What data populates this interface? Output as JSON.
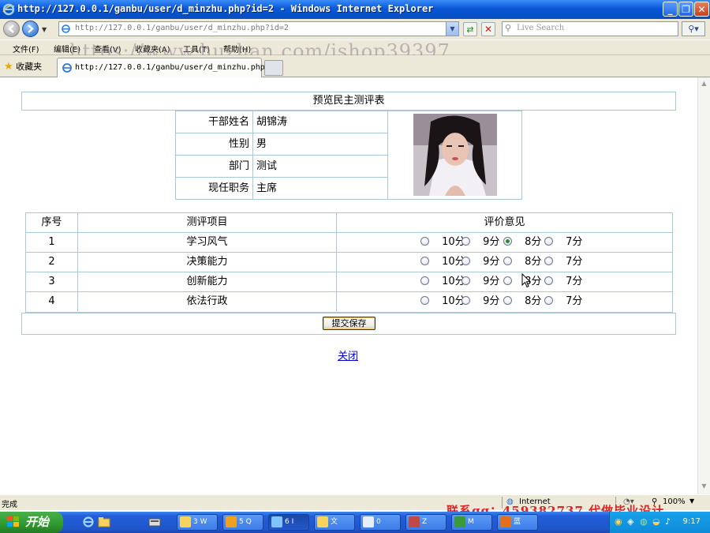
{
  "window": {
    "title": "http://127.0.0.1/ganbu/user/d_minzhu.php?id=2 - Windows Internet Explorer"
  },
  "toolbar": {
    "address": "http://127.0.0.1/ganbu/user/d_minzhu.php?id=2",
    "search_placeholder": "Live Search"
  },
  "menu": [
    {
      "label": "文件(F)"
    },
    {
      "label": "编辑(E)"
    },
    {
      "label": "查看(V)"
    },
    {
      "label": "收藏夹(A)"
    },
    {
      "label": "工具(T)"
    },
    {
      "label": "帮助(H)"
    }
  ],
  "watermark_top": "https://www.huzhan.com/ishop39397",
  "tabs": {
    "favorites": "收藏夹",
    "active_tab": "http://127.0.0.1/ganbu/user/d_minzhu.php?..."
  },
  "page": {
    "title": "预览民主测评表",
    "info": [
      {
        "label": "干部姓名",
        "value": "胡锦涛"
      },
      {
        "label": "性别",
        "value": "男"
      },
      {
        "label": "部门",
        "value": "测试"
      },
      {
        "label": "现任职务",
        "value": "主席"
      }
    ],
    "table_headers": {
      "no": "序号",
      "item": "测评项目",
      "opinion": "评价意见"
    },
    "options": [
      "10分",
      "9分",
      "8分",
      "7分"
    ],
    "rows": [
      {
        "no": "1",
        "item": "学习风气",
        "selected": "8分"
      },
      {
        "no": "2",
        "item": "决策能力",
        "selected": ""
      },
      {
        "no": "3",
        "item": "创新能力",
        "selected": ""
      },
      {
        "no": "4",
        "item": "依法行政",
        "selected": ""
      }
    ],
    "submit_label": "提交保存",
    "close_label": "关闭"
  },
  "status": {
    "left": "完成",
    "zone": "Internet",
    "zoom": "100%"
  },
  "watermark_bottom": "联系qq：459382737 代做毕业设计",
  "taskbar": {
    "start": "开始",
    "items": [
      {
        "label": "3 W"
      },
      {
        "label": "5 Q"
      },
      {
        "label": "6 I"
      },
      {
        "label": "文"
      },
      {
        "label": "0"
      },
      {
        "label": "Z"
      },
      {
        "label": "M"
      },
      {
        "label": "蓝"
      }
    ],
    "clock": "9:17"
  },
  "colors": {
    "titlebar": "#0a58d8",
    "border": "#a8c8d8",
    "link": "#0000cc",
    "taskbar": "#245edb",
    "start": "#2e9a2e"
  }
}
